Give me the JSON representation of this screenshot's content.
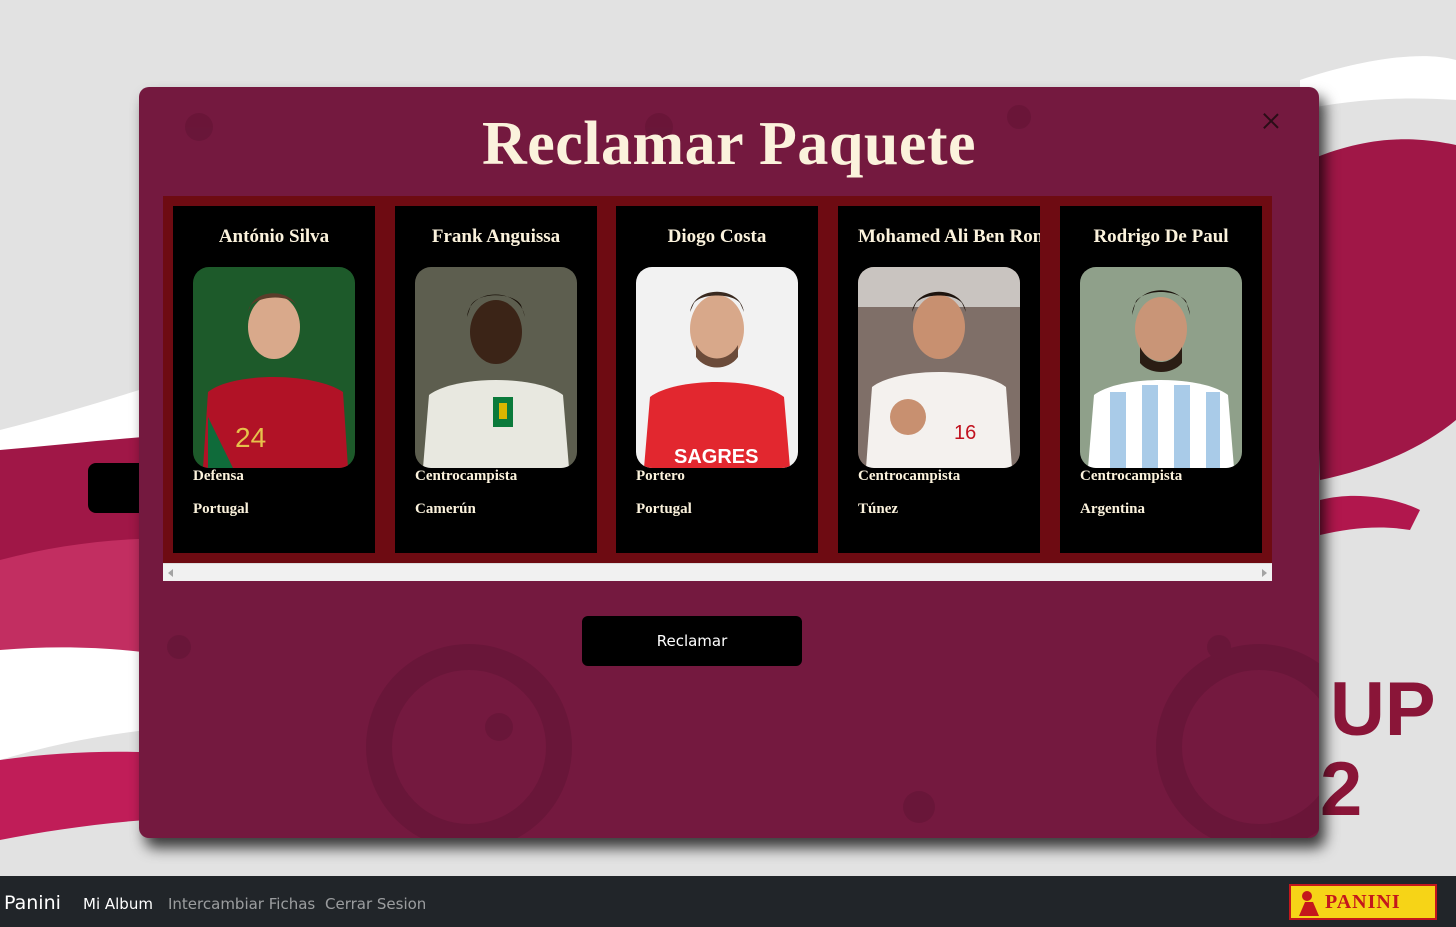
{
  "modal": {
    "title": "Reclamar Paquete",
    "close_icon": "close-icon",
    "claim_button": "Reclamar"
  },
  "cards": [
    {
      "name": "António Silva",
      "position": "Defensa",
      "country": "Portugal",
      "shirt": "#b11226",
      "trim": "#0f6b3a",
      "bg": "#1d5a2a"
    },
    {
      "name": "Frank Anguissa",
      "position": "Centrocampista",
      "country": "Camerún",
      "shirt": "#e8e8e0",
      "trim": "#0b7a3b",
      "bg": "#5d5e4f"
    },
    {
      "name": "Diogo Costa",
      "position": "Portero",
      "country": "Portugal",
      "shirt": "#e2272f",
      "trim": "#ffffff",
      "bg": "#f2f2f2"
    },
    {
      "name": "Mohamed Ali Ben Romdhane",
      "position": "Centrocampista",
      "country": "Túnez",
      "shirt": "#f4f1ee",
      "trim": "#c1121f",
      "bg": "#7f6f68"
    },
    {
      "name": "Rodrigo De Paul",
      "position": "Centrocampista",
      "country": "Argentina",
      "shirt": "#a9cbe8",
      "trim": "#ffffff",
      "bg": "#8fa08a"
    }
  ],
  "navbar": {
    "brand": "Panini",
    "links": [
      "Mi Album",
      "Intercambiar Fichas",
      "Cerrar Sesion"
    ],
    "logo_text": "PANINI"
  },
  "background": {
    "text_line1": "UP",
    "text_line2": "2"
  },
  "colors": {
    "modal_bg": "#74193f",
    "card_frame": "#6e0b12",
    "title_text": "#fbf2dc",
    "navbar_bg": "#212529"
  }
}
